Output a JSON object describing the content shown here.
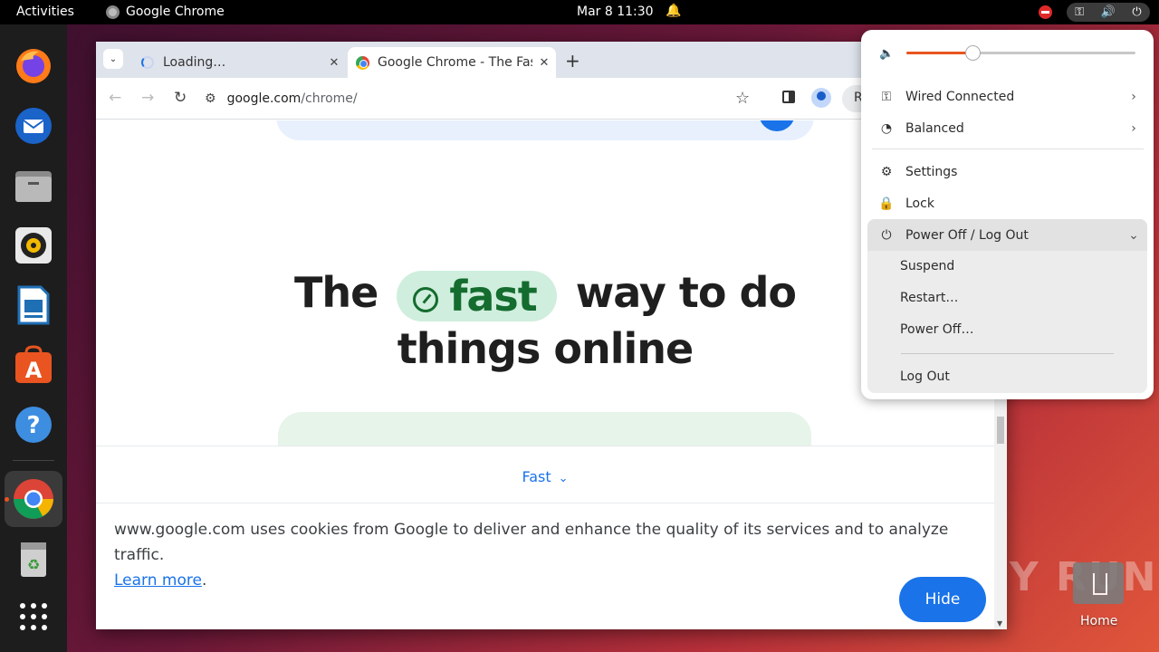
{
  "topbar": {
    "activities": "Activities",
    "app_name": "Google Chrome",
    "clock": "Mar 8  11:30",
    "icons": [
      "notification-bell-icon",
      "recording-indicator-icon",
      "network-icon",
      "volume-icon",
      "power-icon"
    ]
  },
  "dock": {
    "items": [
      "Firefox",
      "Thunderbird",
      "Files",
      "Rhythmbox",
      "LibreOffice Writer",
      "Ubuntu Software",
      "Help",
      "Google Chrome",
      "Trash",
      "Show Applications"
    ]
  },
  "browser": {
    "tabs": [
      {
        "title": "Loading…",
        "state": "loading"
      },
      {
        "title": "Google Chrome - The Fas",
        "state": "active"
      }
    ],
    "url_host": "google.com",
    "url_path": "/chrome/",
    "relaunch_label": "R"
  },
  "page": {
    "headline_pre": "The",
    "headline_chip": "fast",
    "headline_post": "way to do",
    "headline_line2": "things online",
    "subnav_label": "Fast",
    "cookie_text": "www.google.com uses cookies from Google to deliver and enhance the quality of its services and to analyze traffic.",
    "cookie_link": "Learn more",
    "cookie_period": ".",
    "hide_button": "Hide"
  },
  "system_menu": {
    "volume_level": 0.29,
    "wired": "Wired Connected",
    "power_mode": "Balanced",
    "settings": "Settings",
    "lock": "Lock",
    "power_group": "Power Off / Log Out",
    "suspend": "Suspend",
    "restart": "Restart…",
    "power_off": "Power Off…",
    "log_out": "Log Out"
  },
  "desktop": {
    "home_label": "Home",
    "watermark": "ANY RUN"
  },
  "colors": {
    "accent": "#e95420",
    "chrome_blue": "#1a73e8",
    "fast_green": "#146c2e"
  }
}
